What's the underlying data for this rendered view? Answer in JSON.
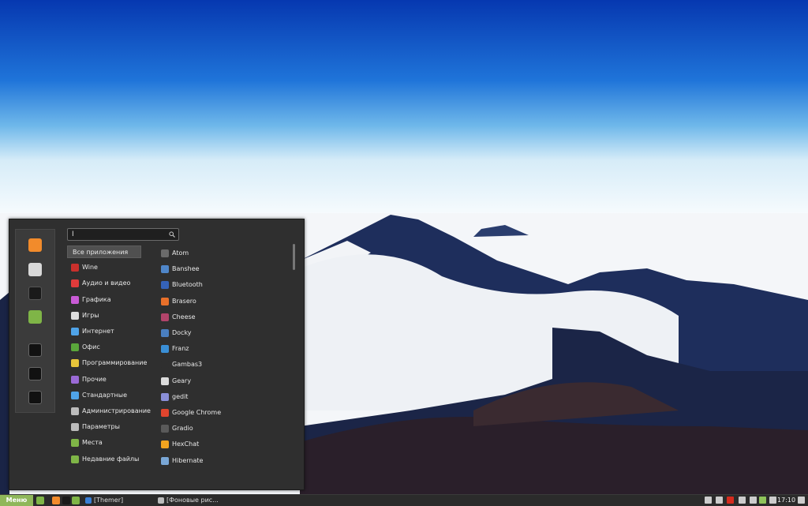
{
  "desktop": {
    "wallpaper": "mountain-above-clouds"
  },
  "menu": {
    "search": {
      "value": "I"
    },
    "favorites": [
      {
        "icon": "firefox-icon",
        "color": "#f28b2b"
      },
      {
        "icon": "settings-toggle-icon",
        "color": "#d8d8d8"
      },
      {
        "icon": "terminal-icon",
        "color": "#1a1a1a"
      },
      {
        "icon": "folder-icon",
        "color": "#7fb547"
      },
      {
        "icon": "lock-icon",
        "color": "#111111"
      },
      {
        "icon": "logout-icon",
        "color": "#111111"
      },
      {
        "icon": "power-icon",
        "color": "#111111"
      }
    ],
    "categories": [
      {
        "label": "Все приложения",
        "icon": "",
        "color": ""
      },
      {
        "label": "Wine",
        "icon": "wine-icon",
        "color": "#c9302c"
      },
      {
        "label": "Аудио и видео",
        "icon": "media-icon",
        "color": "#e03b3b"
      },
      {
        "label": "Графика",
        "icon": "graphics-icon",
        "color": "#c95bd6"
      },
      {
        "label": "Игры",
        "icon": "games-icon",
        "color": "#dddddd"
      },
      {
        "label": "Интернет",
        "icon": "internet-icon",
        "color": "#4fa3e8"
      },
      {
        "label": "Офис",
        "icon": "office-icon",
        "color": "#5aa63b"
      },
      {
        "label": "Программирование",
        "icon": "programming-icon",
        "color": "#e8c53a"
      },
      {
        "label": "Прочие",
        "icon": "other-icon",
        "color": "#9a6ad6"
      },
      {
        "label": "Стандартные",
        "icon": "accessories-icon",
        "color": "#4fa3e8"
      },
      {
        "label": "Администрирование",
        "icon": "administration-icon",
        "color": "#bbbbbb"
      },
      {
        "label": "Параметры",
        "icon": "preferences-icon",
        "color": "#bbbbbb"
      },
      {
        "label": "Места",
        "icon": "places-folder-icon",
        "color": "#7fb547"
      },
      {
        "label": "Недавние файлы",
        "icon": "recent-folder-icon",
        "color": "#7fb547"
      }
    ],
    "apps": [
      {
        "label": "Atom",
        "icon": "atom-icon",
        "color": "#6b6b6b"
      },
      {
        "label": "Banshee",
        "icon": "banshee-icon",
        "color": "#4f86c9"
      },
      {
        "label": "Bluetooth",
        "icon": "bluetooth-icon",
        "color": "#3563b8"
      },
      {
        "label": "Brasero",
        "icon": "brasero-icon",
        "color": "#e8702a"
      },
      {
        "label": "Cheese",
        "icon": "cheese-icon",
        "color": "#b2446a"
      },
      {
        "label": "Docky",
        "icon": "docky-icon",
        "color": "#4a7fc0"
      },
      {
        "label": "Franz",
        "icon": "franz-icon",
        "color": "#3a8fd6"
      },
      {
        "label": "Gambas3",
        "icon": "gambas-icon",
        "color": "#2f2f2f"
      },
      {
        "label": "Geary",
        "icon": "geary-icon",
        "color": "#dcdcdc"
      },
      {
        "label": "gedit",
        "icon": "gedit-icon",
        "color": "#8a8fd8"
      },
      {
        "label": "Google Chrome",
        "icon": "chrome-icon",
        "color": "#e0452e"
      },
      {
        "label": "Gradio",
        "icon": "gradio-icon",
        "color": "#5a5a5a"
      },
      {
        "label": "HexChat",
        "icon": "hexchat-icon",
        "color": "#f2a31f"
      },
      {
        "label": "Hibernate",
        "icon": "hibernate-icon",
        "color": "#7aa7d6"
      }
    ]
  },
  "panel": {
    "menu_label": "Меню",
    "launchers": [
      {
        "icon": "show-desktop-icon",
        "color": "#7fb547"
      },
      {
        "icon": "firefox-icon",
        "color": "#f28b2b"
      },
      {
        "icon": "terminal-icon",
        "color": "#1a1a1a"
      },
      {
        "icon": "folder-icon",
        "color": "#7fb547"
      }
    ],
    "tasks": [
      {
        "label": "[Themer]",
        "icon": "themer-icon",
        "color": "#3a7fd6"
      },
      {
        "label": "[Фоновые рис...",
        "icon": "wallpaper-app-icon",
        "color": "#bbbbbb"
      }
    ],
    "tray": [
      {
        "icon": "display-icon",
        "color": "#cccccc"
      },
      {
        "icon": "user-icon",
        "color": "#cccccc"
      },
      {
        "icon": "keyboard-layout-flag-icon",
        "color": "#d52b1e"
      },
      {
        "icon": "volume-icon",
        "color": "#cccccc"
      },
      {
        "icon": "network-icon",
        "color": "#cccccc"
      },
      {
        "icon": "update-shield-icon",
        "color": "#8fc35a"
      },
      {
        "icon": "battery-icon",
        "color": "#cccccc"
      }
    ],
    "clock": "17:10",
    "tray_end_icon": "notifications-icon"
  }
}
